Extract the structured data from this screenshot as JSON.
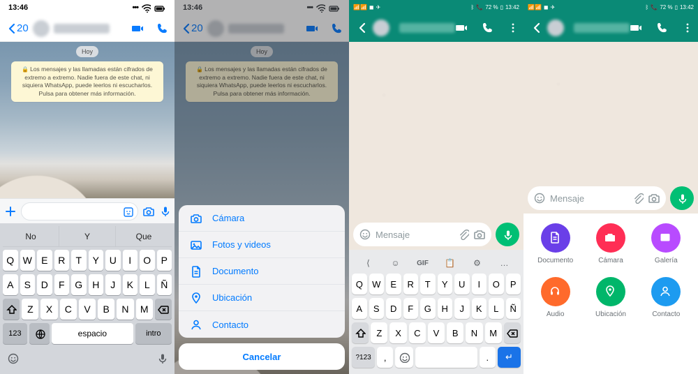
{
  "ios": {
    "time": "13:46",
    "back_count": "20",
    "date_pill": "Hoy",
    "notice": "Los mensajes y las llamadas están cifrados de extremo a extremo. Nadie fuera de este chat, ni siquiera WhatsApp, puede leerlos ni escucharlos. Pulsa para obtener más información.",
    "suggestions": [
      "No",
      "Y",
      "Que"
    ],
    "row1": [
      "Q",
      "W",
      "E",
      "R",
      "T",
      "Y",
      "U",
      "I",
      "O",
      "P"
    ],
    "row2": [
      "A",
      "S",
      "D",
      "F",
      "G",
      "H",
      "J",
      "K",
      "L",
      "Ñ"
    ],
    "row3": [
      "Z",
      "X",
      "C",
      "V",
      "B",
      "N",
      "M"
    ],
    "key_123": "123",
    "key_space": "espacio",
    "key_intro": "intro"
  },
  "sheet": {
    "items": [
      "Cámara",
      "Fotos y videos",
      "Documento",
      "Ubicación",
      "Contacto"
    ],
    "cancel": "Cancelar"
  },
  "android": {
    "battery": "72 %",
    "time": "13:42",
    "placeholder": "Mensaje",
    "tools": [
      "⟨",
      "☺",
      "GIF",
      "📋",
      "⚙",
      "…"
    ],
    "row1": [
      "Q",
      "W",
      "E",
      "R",
      "T",
      "Y",
      "U",
      "I",
      "O",
      "P"
    ],
    "row2": [
      "A",
      "S",
      "D",
      "F",
      "G",
      "H",
      "J",
      "K",
      "L",
      "Ñ"
    ],
    "row3": [
      "Z",
      "X",
      "C",
      "V",
      "B",
      "N",
      "M"
    ],
    "key_sym": "?123",
    "attach": [
      {
        "label": "Documento",
        "color": "#6a3fe8",
        "icon": "doc"
      },
      {
        "label": "Cámara",
        "color": "#ff2e55",
        "icon": "cam"
      },
      {
        "label": "Galería",
        "color": "#b84bff",
        "icon": "gal"
      },
      {
        "label": "Audio",
        "color": "#ff6a2b",
        "icon": "aud"
      },
      {
        "label": "Ubicación",
        "color": "#00b66a",
        "icon": "loc"
      },
      {
        "label": "Contacto",
        "color": "#1d9bf0",
        "icon": "con"
      }
    ]
  }
}
